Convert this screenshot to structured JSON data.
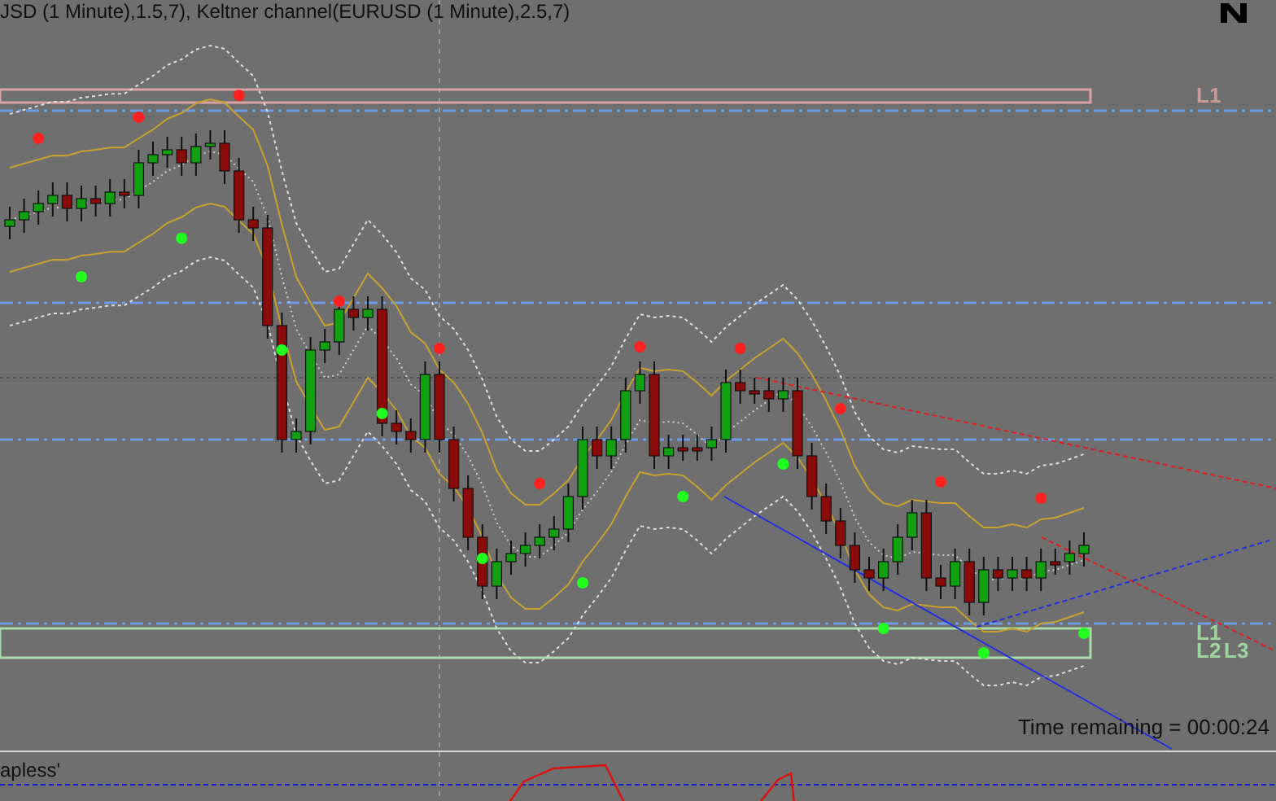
{
  "header": {
    "indicator_text": "JSD (1 Minute),1.5,7), Keltner channel(EURUSD (1 Minute),2.5,7)"
  },
  "levels": [
    {
      "label": "L1",
      "color": "#c89a9a"
    },
    {
      "label": "L1",
      "color": "#9fd49f"
    },
    {
      "label": "L2",
      "color": "#9fd49f"
    },
    {
      "label": "L3",
      "color": "#9fd49f"
    }
  ],
  "timer": "Time remaining = 00:00:24",
  "subwindow": {
    "label": "apless'"
  }
}
